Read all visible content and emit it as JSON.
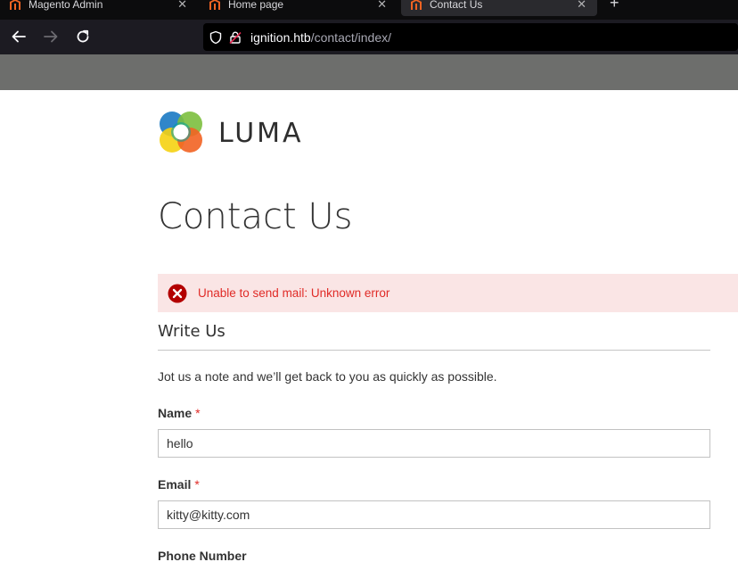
{
  "browser": {
    "tabs": [
      {
        "title": "Magento Admin",
        "active": false
      },
      {
        "title": "Home page",
        "active": false
      },
      {
        "title": "Contact Us",
        "active": true
      }
    ],
    "new_tab_label": "+",
    "url_host": "ignition.htb",
    "url_path": "/contact/index/"
  },
  "site": {
    "logo_text": "LUMA"
  },
  "page": {
    "title": "Contact Us",
    "error_message": "Unable to send mail: Unknown error",
    "form": {
      "legend": "Write Us",
      "note": "Jot us a note and we’ll get back to you as quickly as possible.",
      "required_marker": "*",
      "fields": {
        "name": {
          "label": "Name",
          "value": "hello"
        },
        "email": {
          "label": "Email",
          "value": "kitty@kitty.com"
        },
        "phone": {
          "label": "Phone Number"
        }
      }
    }
  },
  "colors": {
    "error_text": "#e02b27",
    "error_background": "#fae5e5",
    "header_strip": "#6d6e6c"
  }
}
